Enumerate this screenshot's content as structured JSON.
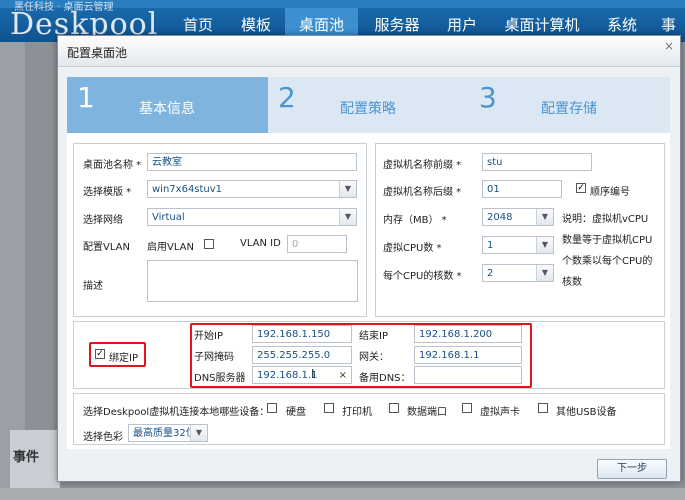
{
  "app": {
    "logo": "Deskpool",
    "logo_sub": "黑任科技 · 桌面云管理",
    "nav": [
      "首页",
      "模板",
      "桌面池",
      "服务器",
      "用户",
      "桌面计算机",
      "系统",
      "事"
    ],
    "active_nav": "桌面池",
    "bg_section": "事件"
  },
  "dialog": {
    "title": "配置桌面池",
    "close": "×",
    "steps": [
      {
        "num": "1",
        "label": "基本信息"
      },
      {
        "num": "2",
        "label": "配置策略"
      },
      {
        "num": "3",
        "label": "配置存储"
      }
    ],
    "left": {
      "pool_name_label": "桌面池名称 *",
      "pool_name_value": "云教室",
      "template_label": "选择模版 *",
      "template_value": "win7x64stuv1",
      "network_label": "选择网络",
      "network_value": "Virtual",
      "vlan_label": "配置VLAN",
      "enable_vlan_label": "启用VLAN",
      "vlan_id_label": "VLAN ID",
      "vlan_id_placeholder": "0",
      "desc_label": "描述"
    },
    "right": {
      "prefix_label": "虚拟机名称前缀 *",
      "prefix_value": "stu",
      "suffix_label": "虚拟机名称后缀 *",
      "suffix_value": "01",
      "seq_label": "顺序编号",
      "mem_label": "内存（MB） *",
      "mem_value": "2048",
      "cpu_label": "虚拟CPU数 *",
      "cpu_value": "1",
      "cores_label": "每个CPU的核数 *",
      "cores_value": "2",
      "note_lines": [
        "说明：虚拟机vCPU",
        "数量等于虚拟机CPU",
        "个数乘以每个CPU的",
        "核数"
      ]
    },
    "ip": {
      "bind_label": "绑定IP",
      "start_ip_label": "开始IP",
      "start_ip_value": "192.168.1.150",
      "end_ip_label": "结束IP",
      "end_ip_value": "192.168.1.200",
      "mask_label": "子网掩码",
      "mask_value": "255.255.255.0",
      "gateway_label": "网关：",
      "gateway_value": "192.168.1.1",
      "dns_label": "DNS服务器",
      "dns_value": "192.168.1.1",
      "dns_clear": "×",
      "alt_dns_label": "备用DNS："
    },
    "devices": {
      "label": "选择Deskpool虚拟机连接本地哪些设备：",
      "items": [
        "硬盘",
        "打印机",
        "数据端口",
        "虚拟声卡",
        "其他USB设备"
      ],
      "color_label": "选择色彩",
      "color_value": "最高质量32位"
    },
    "next_button": "下一步"
  }
}
